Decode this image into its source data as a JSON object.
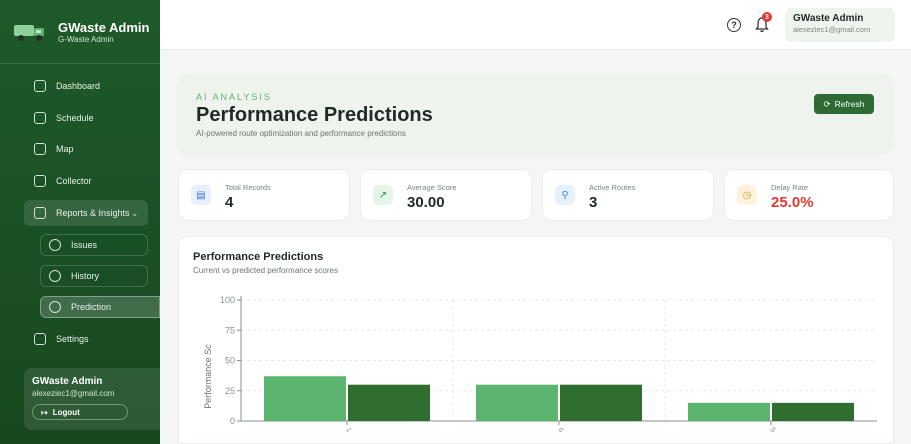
{
  "brand": {
    "title": "GWaste Admin",
    "subtitle": "G-Waste Admin"
  },
  "sidebar": {
    "items": [
      {
        "label": "Dashboard",
        "icon": "grid-icon"
      },
      {
        "label": "Schedule",
        "icon": "calendar-icon"
      },
      {
        "label": "Map",
        "icon": "map-icon"
      },
      {
        "label": "Collector",
        "icon": "users-icon"
      },
      {
        "label": "Reports & Insights",
        "icon": "file-icon"
      }
    ],
    "sub_items": [
      {
        "label": "Issues",
        "icon": "warning-icon"
      },
      {
        "label": "History",
        "icon": "history-icon"
      },
      {
        "label": "Prediction",
        "icon": "prediction-icon"
      }
    ],
    "settings_label": "Settings",
    "user": {
      "name": "GWaste Admin",
      "email": "alexeziec1@gmail.com"
    },
    "logout_label": "Logout"
  },
  "topbar": {
    "notification_count": "3",
    "user_name": "GWaste Admin",
    "user_email": "alexeziec1@gmail.com"
  },
  "hero": {
    "kicker": "AI ANALYSIS",
    "title": "Performance Predictions",
    "subtitle": "AI-powered route optimization and performance predictions",
    "refresh_label": "Refresh"
  },
  "stats": [
    {
      "label": "Total Records",
      "value": "4",
      "icon": "bar-chart-icon",
      "accent": "#eaf0fb"
    },
    {
      "label": "Average Score",
      "value": "30.00",
      "icon": "trend-up-icon",
      "accent": "#e6f5ea"
    },
    {
      "label": "Active Routes",
      "value": "3",
      "icon": "map-pin-icon",
      "accent": "#e8f1fb"
    },
    {
      "label": "Delay Rate",
      "value": "25.0%",
      "icon": "clock-icon",
      "accent": "#fdf3dc",
      "value_color": "#e03a32"
    }
  ],
  "panel": {
    "title": "Performance Predictions",
    "subtitle": "Current vs predicted performance scores"
  },
  "chart_data": {
    "type": "bar",
    "categories": [
      "1",
      "6",
      "5"
    ],
    "series": [
      {
        "values": [
          37,
          30,
          15
        ],
        "color": "#5cb56e"
      },
      {
        "values": [
          30,
          30,
          15
        ],
        "color": "#2f6e2f"
      }
    ],
    "ylabel": "Performance Sc",
    "yticks": [
      0,
      25,
      50,
      75,
      100
    ],
    "ylim": [
      0,
      100
    ],
    "grid": true
  }
}
